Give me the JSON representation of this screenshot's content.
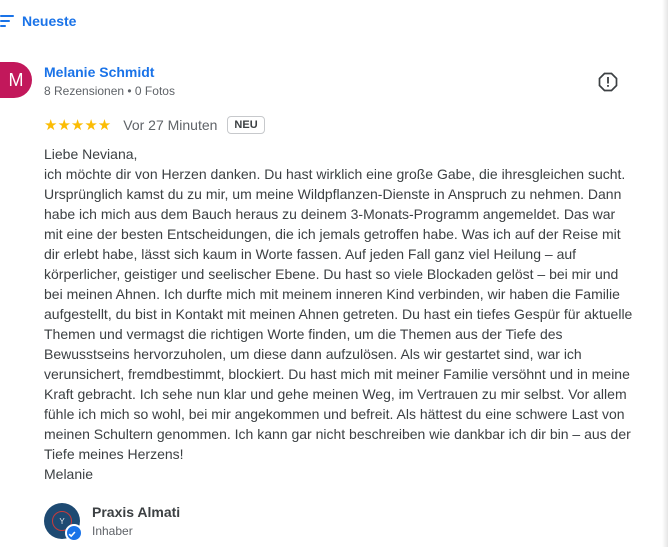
{
  "sort": {
    "label": "Neueste",
    "icon": "sort-icon"
  },
  "review": {
    "avatar_letter": "M",
    "avatar_color": "#c2185b",
    "author": "Melanie Schmidt",
    "meta": "8 Rezensionen • 0 Fotos",
    "rating": 5,
    "stars": "★★★★★",
    "time": "Vor 27 Minuten",
    "badge": "NEU",
    "report_icon": "report-icon",
    "lines": [
      "Liebe Neviana,",
      "ich möchte dir von Herzen danken. Du hast wirklich eine große Gabe, die ihresgleichen sucht. Ursprünglich kamst du zu mir, um meine Wildpflanzen-Dienste in Anspruch zu nehmen. Dann habe ich mich aus dem Bauch heraus zu deinem 3-Monats-Programm angemeldet. Das war mit eine der besten Entscheidungen, die ich jemals getroffen habe. Was ich auf der Reise mit dir erlebt habe, lässt sich kaum in Worte fassen. Auf jeden Fall ganz viel Heilung – auf körperlicher, geistiger und seelischer Ebene. Du hast so viele Blockaden gelöst – bei mir und bei meinen Ahnen. Ich durfte mich mit meinem inneren Kind verbinden, wir haben die Familie aufgestellt, du bist in Kontakt mit meinen Ahnen getreten. Du hast ein tiefes Gespür für aktuelle Themen und vermagst die richtigen Worte finden, um die Themen aus der Tiefe des Bewusstseins hervorzuholen, um diese dann aufzulösen. Als wir gestartet sind, war ich verunsichert, fremdbestimmt, blockiert. Du hast mich mit meiner Familie versöhnt und in meine Kraft gebracht. Ich sehe nun klar und gehe meinen Weg, im Vertrauen zu mir selbst. Vor allem fühle ich mich so wohl, bei mir angekommen und befreit. Als hättest du eine schwere Last von meinen Schultern genommen. Ich kann gar nicht beschreiben wie dankbar ich dir bin – aus der Tiefe meines Herzens!",
      "Melanie"
    ]
  },
  "owner": {
    "name": "Praxis Almati",
    "role": "Inhaber",
    "logo_letter": "Y",
    "verified_icon": "verified-icon"
  },
  "colors": {
    "accent": "#1a73e8",
    "star": "#fbbc04",
    "avatar": "#c2185b"
  }
}
